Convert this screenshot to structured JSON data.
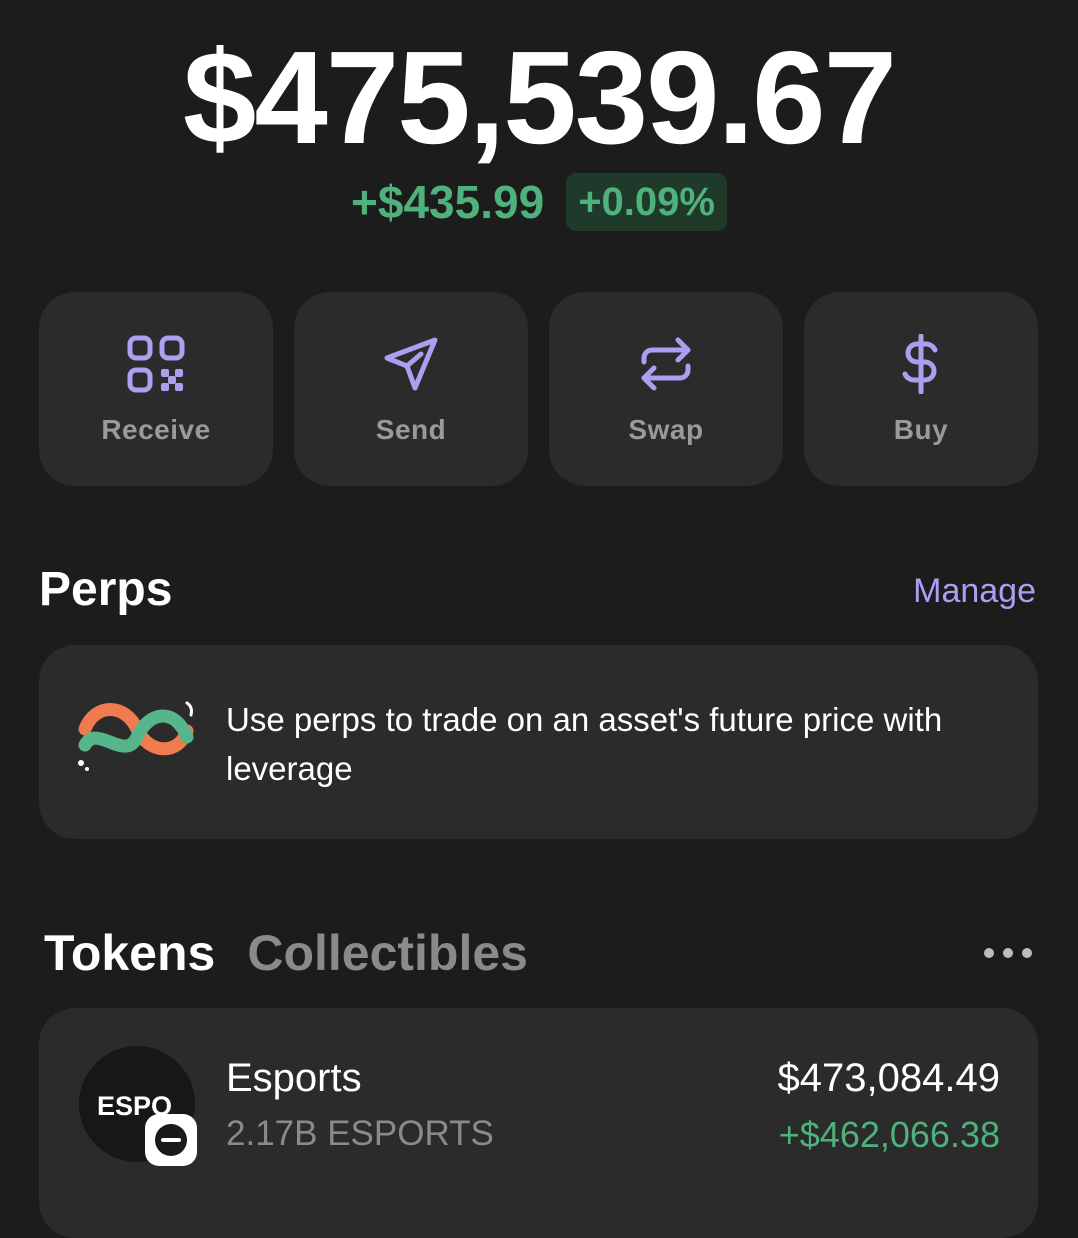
{
  "balance": {
    "total": "$475,539.67",
    "change_amount": "+$435.99",
    "change_percent": "+0.09%"
  },
  "actions": [
    {
      "label": "Receive",
      "icon": "qr-code-icon"
    },
    {
      "label": "Send",
      "icon": "send-icon"
    },
    {
      "label": "Swap",
      "icon": "swap-icon"
    },
    {
      "label": "Buy",
      "icon": "dollar-icon"
    }
  ],
  "perps": {
    "title": "Perps",
    "manage_label": "Manage",
    "promo_text": "Use perps to trade on an asset's future price with leverage",
    "promo_icon": "perps-knot-icon"
  },
  "tabs": {
    "tokens": "Tokens",
    "collectibles": "Collectibles",
    "more_icon": "more-dots-icon"
  },
  "tokens": [
    {
      "avatar_text": "ESPO",
      "name": "Esports",
      "amount": "2.17B ESPORTS",
      "value": "$473,084.49",
      "change": "+$462,066.38",
      "chain_badge_icon": "chain-badge-icon"
    }
  ],
  "colors": {
    "background": "#1c1c1c",
    "card": "#2b2b2b",
    "accent": "#ab9ff2",
    "positive": "#4fb17c",
    "muted": "#8a8a8a"
  }
}
